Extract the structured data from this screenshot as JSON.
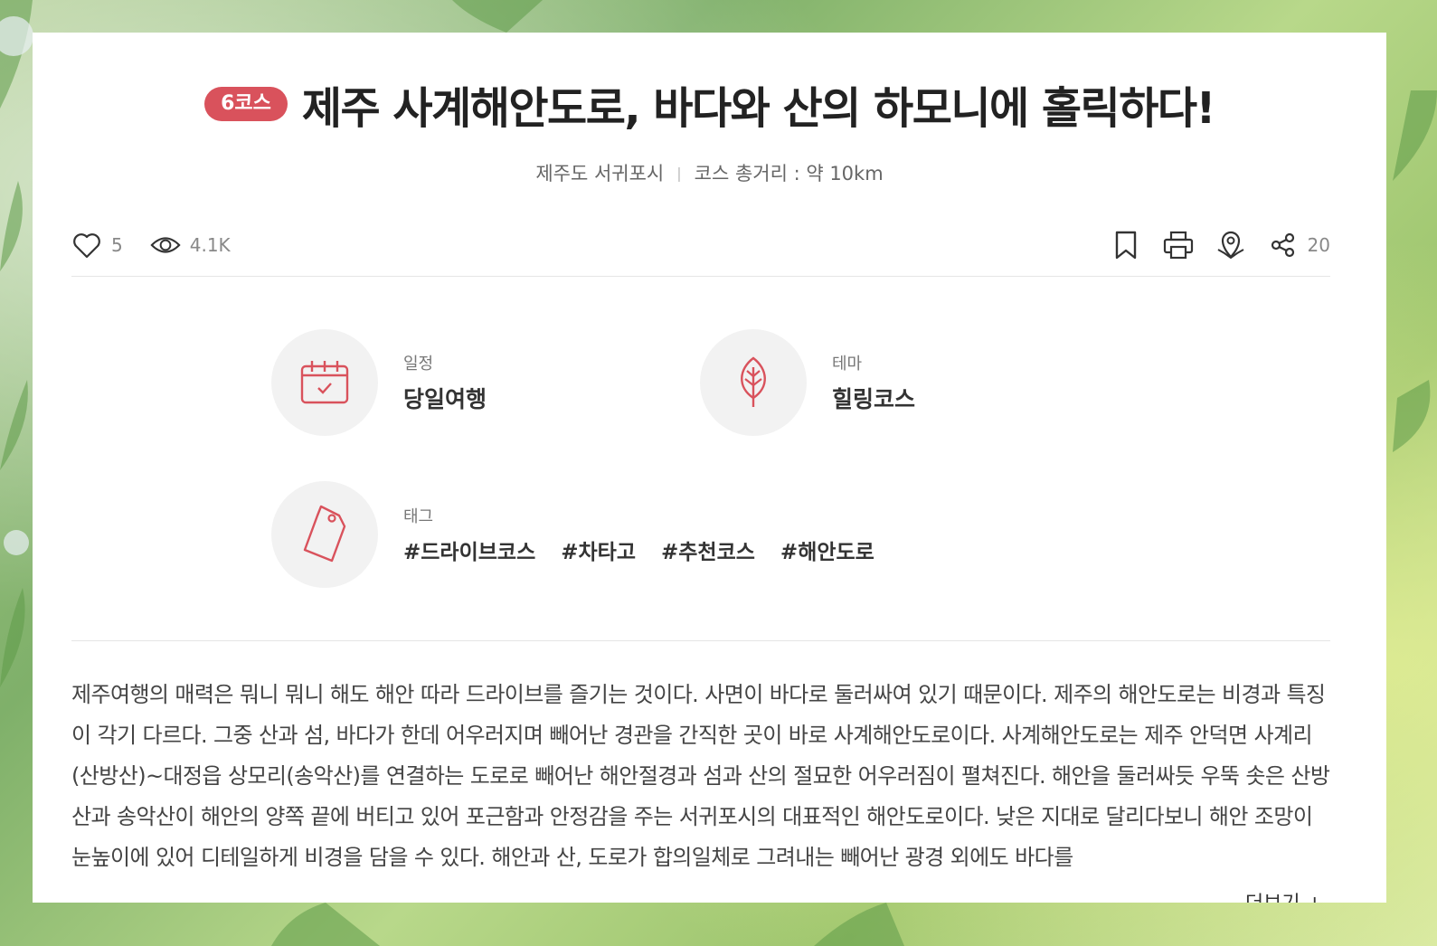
{
  "header": {
    "badge": "6코스",
    "title": "제주 사계해안도로, 바다와 산의 하모니에 홀릭하다!",
    "location": "제주도 서귀포시",
    "separator": "|",
    "distance": "코스 총거리 : 약 10km"
  },
  "toolbar": {
    "likes": "5",
    "views": "4.1K",
    "shares": "20",
    "icons": [
      "heart-icon",
      "eye-icon",
      "bookmark-icon",
      "print-icon",
      "map-pin-icon",
      "share-icon"
    ]
  },
  "info": {
    "schedule": {
      "label": "일정",
      "value": "당일여행",
      "icon": "calendar-icon"
    },
    "theme": {
      "label": "테마",
      "value": "힐링코스",
      "icon": "leaf-icon"
    },
    "tags": {
      "label": "태그",
      "icon": "tag-icon",
      "items": [
        "#드라이브코스",
        "#차타고",
        "#추천코스",
        "#해안도로"
      ]
    }
  },
  "body": {
    "text": "제주여행의 매력은 뭐니 뭐니 해도 해안 따라 드라이브를 즐기는 것이다. 사면이 바다로 둘러싸여 있기 때문이다. 제주의 해안도로는 비경과 특징이 각기 다르다. 그중 산과 섬, 바다가 한데 어우러지며 빼어난 경관을 간직한 곳이 바로 사계해안도로이다. 사계해안도로는 제주 안덕면 사계리(산방산)~대정읍 상모리(송악산)를 연결하는 도로로 빼어난 해안절경과 섬과 산의 절묘한 어우러짐이 펼쳐진다. 해안을 둘러싸듯 우뚝 솟은 산방산과 송악산이 해안의 양쪽 끝에 버티고 있어 포근함과 안정감을 주는 서귀포시의 대표적인 해안도로이다. 낮은 지대로 달리다보니 해안 조망이 눈높이에 있어 디테일하게 비경을 담을 수 있다. 해안과 산, 도로가 합의일체로 그려내는 빼어난 광경 외에도 바다를",
    "more": "더보기 +"
  },
  "colors": {
    "accent": "#d9525c",
    "icon_red": "#d9525c"
  }
}
